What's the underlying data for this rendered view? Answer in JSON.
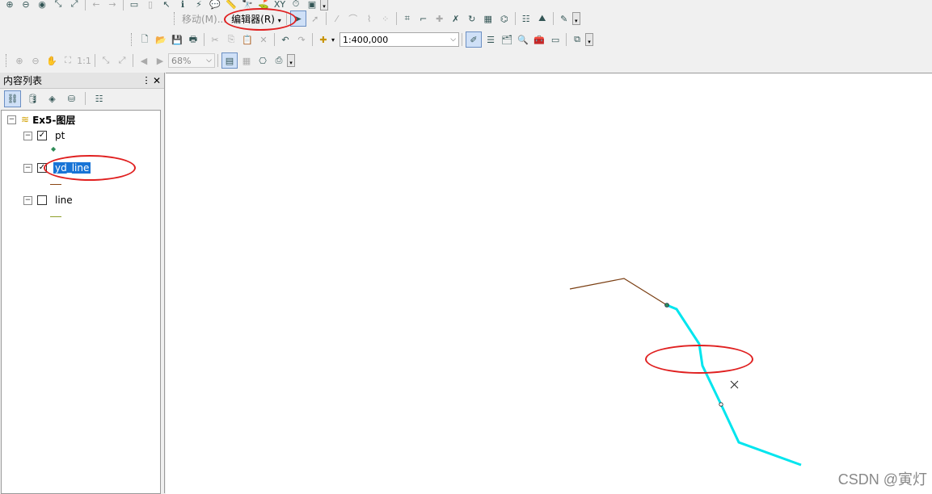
{
  "toolbar": {
    "move_label": "移动(M)...",
    "editor_label": "编辑器(R)",
    "scale_value": "1:400,000",
    "zoom_value": "68%"
  },
  "toc": {
    "title": "内容列表",
    "pin": "ⵗ",
    "close": "✕",
    "data_frame": "Ex5-图层",
    "layers": [
      {
        "name": "pt",
        "checked": true,
        "symbol_color": "#2e8b57"
      },
      {
        "name": "yd_line",
        "checked": true,
        "selected": true,
        "symbol_color": "#8b4513"
      },
      {
        "name": "line",
        "checked": false,
        "symbol_color": "#8fa02b"
      }
    ]
  },
  "map": {
    "colors": {
      "selected_line": "#00e5ee",
      "brown_line": "#7a3e12",
      "annotation": "#e02020"
    }
  },
  "watermark": "CSDN @寅灯"
}
